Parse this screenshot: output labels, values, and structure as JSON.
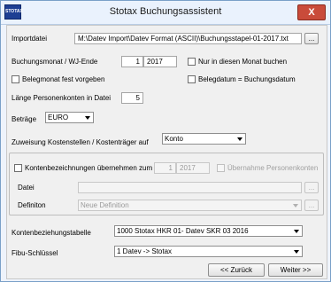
{
  "window": {
    "title": "Stotax Buchungsassistent",
    "icon_text": "STOTAX",
    "close_glyph": "X"
  },
  "import": {
    "label": "Importdatei",
    "path": "M:\\Datev Import\\Datev Format (ASCII)\\Buchungsstapel-01-2017.txt",
    "browse": "..."
  },
  "buchungsmonat": {
    "label": "Buchungsmonat / WJ-Ende",
    "month": "1",
    "year": "2017"
  },
  "nur_monat": {
    "label": "Nur in diesen Monat buchen",
    "checked": false
  },
  "belegmonat": {
    "label": "Belegmonat fest vorgeben",
    "checked": false
  },
  "belegdatum": {
    "label": "Belegdatum = Buchungsdatum",
    "checked": false
  },
  "personenkonten": {
    "label": "Länge Personenkonten in Datei",
    "value": "5"
  },
  "betraege": {
    "label": "Beträge",
    "value": "EURO"
  },
  "zuweisung": {
    "label": "Zuweisung Kostenstellen / Kostenträger auf",
    "value": "Konto"
  },
  "kontenbez": {
    "label": "Kontenbezeichnungen übernehmen zum",
    "month": "1",
    "year": "2017",
    "uebernahme_label": "Übernahme Personenkonten",
    "datei_label": "Datei",
    "datei_value": "",
    "datei_browse": "...",
    "definition_label": "Definiton",
    "definition_value": "Neue Definition",
    "definition_browse": "..."
  },
  "kontenbeziehungstabelle": {
    "label": "Kontenbeziehungstabelle",
    "value": "1000 Stotax HKR 01- Datev SKR 03 2016"
  },
  "fibu": {
    "label": "Fibu-Schlüssel",
    "value": "1 Datev -> Stotax"
  },
  "nav": {
    "back": "<< Zurück",
    "next": "Weiter >>"
  }
}
